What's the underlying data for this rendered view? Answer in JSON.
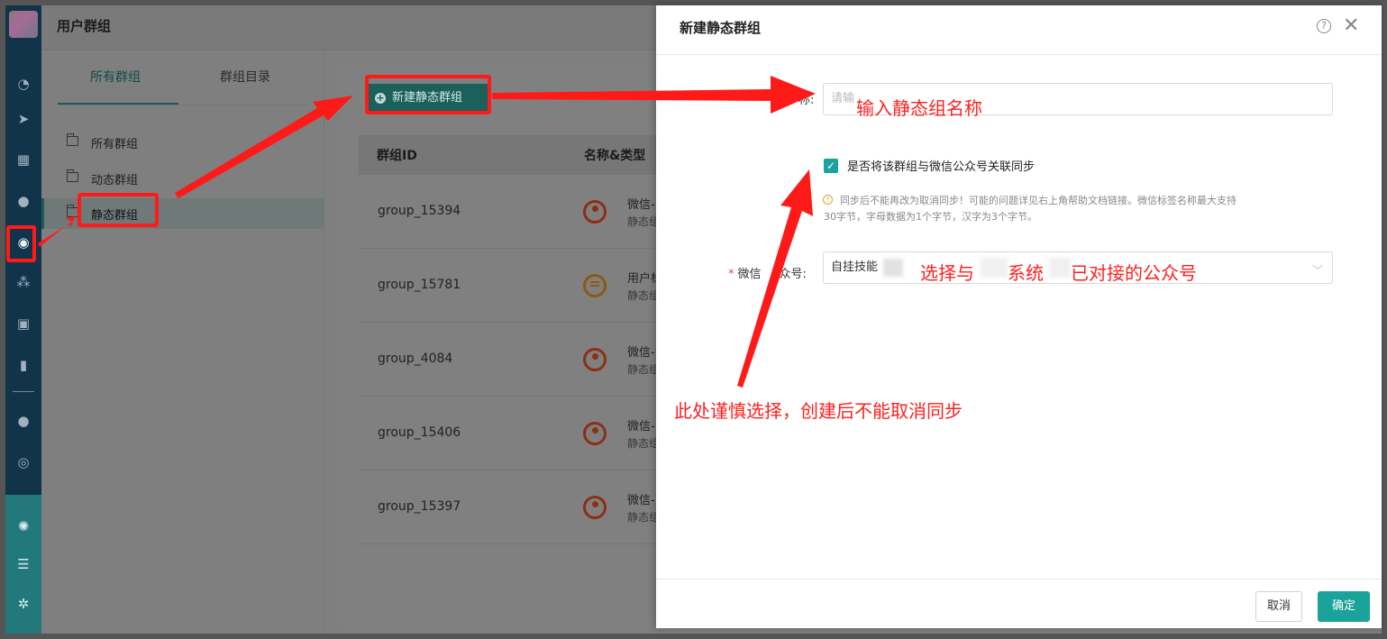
{
  "header": {
    "title": "用户群组"
  },
  "tabs": [
    {
      "label": "所有群组",
      "active": true
    },
    {
      "label": "群组目录",
      "active": false
    }
  ],
  "tree": [
    {
      "label": "所有群组"
    },
    {
      "label": "动态群组"
    },
    {
      "label": "静态群组",
      "selected": true
    }
  ],
  "toolbar": {
    "new_static_group_label": "新建静态群组"
  },
  "table": {
    "columns": [
      "群组ID",
      "名称&类型"
    ],
    "rows": [
      {
        "id": "group_15394",
        "name": "微信-",
        "type": "静态组",
        "icon": "user-circle-icon"
      },
      {
        "id": "group_15781",
        "name": "用户标",
        "type": "静态组",
        "icon": "list-circle-icon"
      },
      {
        "id": "group_4084",
        "name": "微信-",
        "type": "静态组",
        "icon": "user-circle-icon"
      },
      {
        "id": "group_15406",
        "name": "微信-",
        "type": "静态组",
        "icon": "user-circle-icon"
      },
      {
        "id": "group_15397",
        "name": "微信-",
        "type": "静态组",
        "icon": "user-circle-icon"
      }
    ]
  },
  "drawer": {
    "title": "新建静态群组",
    "name_label_suffix": "称:",
    "name_placeholder": "请输",
    "sync_checkbox_label": "是否将该群组与微信公众号关联同步",
    "sync_checked": true,
    "warning_line1": "同步后不能再改为取消同步！可能的问题详见右上角帮助文档链接。微信标签名称最大支持",
    "warning_line2": "30字节，字母数据为1个字节，汉字为3个字节。",
    "account_label_prefix": "微信",
    "account_label_suffix": "众号:",
    "account_value": "自挂技能",
    "cancel_label": "取消",
    "ok_label": "确定"
  },
  "annotations": {
    "name_hint": "输入静态组名称",
    "account_hint_a": "选择与",
    "account_hint_b": "系统",
    "account_hint_c": "已对接的公众号",
    "sync_hint": "此处谨慎选择，创建后不能取消同步"
  },
  "colors": {
    "accent": "#1aa39a",
    "annotation": "#ff1a1a",
    "rail": "#12344a",
    "rail_bottom": "#22787a"
  }
}
